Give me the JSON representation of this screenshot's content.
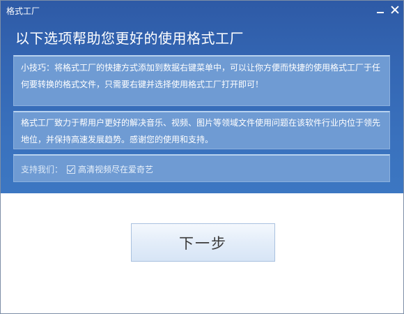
{
  "window": {
    "title": "格式工厂"
  },
  "header": {
    "headline": "以下选项帮助您更好的使用格式工厂"
  },
  "tip": {
    "text": "小技巧：将格式工厂的快捷方式添加到数据右键菜单中，可以让你方便而快捷的使用格式工厂于任何要转换的格式文件，只需要右键并选择使用格式工厂打开即可！"
  },
  "about": {
    "text": "格式工厂致力于帮用户更好的解决音乐、视频、图片等领域文件使用问题在该软件行业内位于领先地位，并保持高速发展趋势。感谢您的使用和支持。"
  },
  "support": {
    "label": "支持我们：",
    "checkbox_checked": true,
    "option_label": "高清视频尽在爱奇艺"
  },
  "buttons": {
    "next_label": "下一步"
  },
  "icons": {
    "minimize": "minimize-icon",
    "close": "close-icon",
    "checkbox": "checkbox-icon"
  },
  "colors": {
    "header_blue": "#3467b4",
    "panel_blue": "#6f9bd3",
    "button_face": "#e3edf9"
  }
}
